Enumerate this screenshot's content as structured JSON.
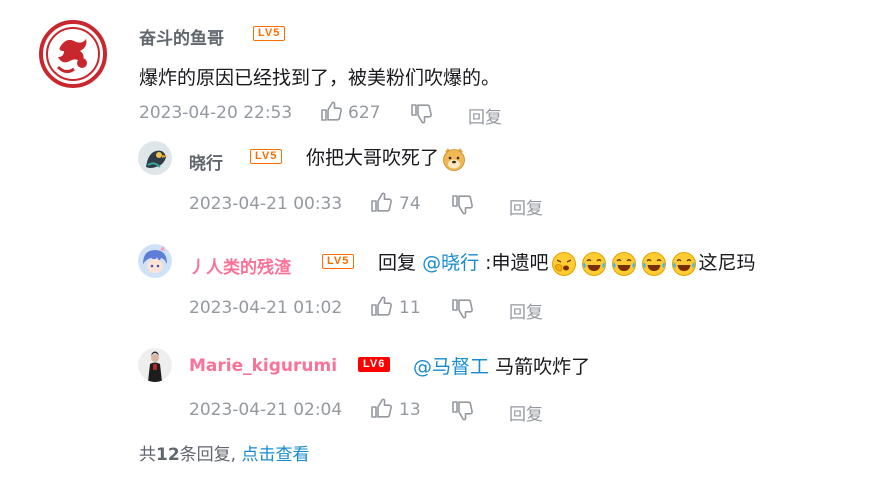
{
  "root_comment": {
    "username": "奋斗的鱼哥",
    "level": "LV5",
    "content": "爆炸的原因已经找到了，被美粉们吹爆的。",
    "time": "2023-04-20 22:53",
    "likes": "627",
    "reply_label": "回复"
  },
  "replies": [
    {
      "username": "晓行",
      "level": "LV5",
      "content": "你把大哥吹死了",
      "time": "2023-04-21 00:33",
      "likes": "74",
      "reply_label": "回复"
    },
    {
      "username": "丿人类的残渣",
      "level": "LV5",
      "prefix": "回复",
      "mention": "@晓行",
      "content_a": ":申遗吧",
      "content_b": "这尼玛",
      "time": "2023-04-21 01:02",
      "likes": "11",
      "reply_label": "回复"
    },
    {
      "username": "Marie_kigurumi",
      "level": "LV6",
      "mention": "@马督工",
      "content": "马箭吹炸了",
      "time": "2023-04-21 02:04",
      "likes": "13",
      "reply_label": "回复"
    }
  ],
  "footer": {
    "prefix": "共",
    "count": "12",
    "suffix": "条回复,",
    "link": "点击查看"
  },
  "colors": {
    "pink_name": "#fb7299",
    "link": "#178bcf",
    "lv5": "#ff6c00",
    "lv6": "#ff0000",
    "meta": "#9499a0"
  }
}
